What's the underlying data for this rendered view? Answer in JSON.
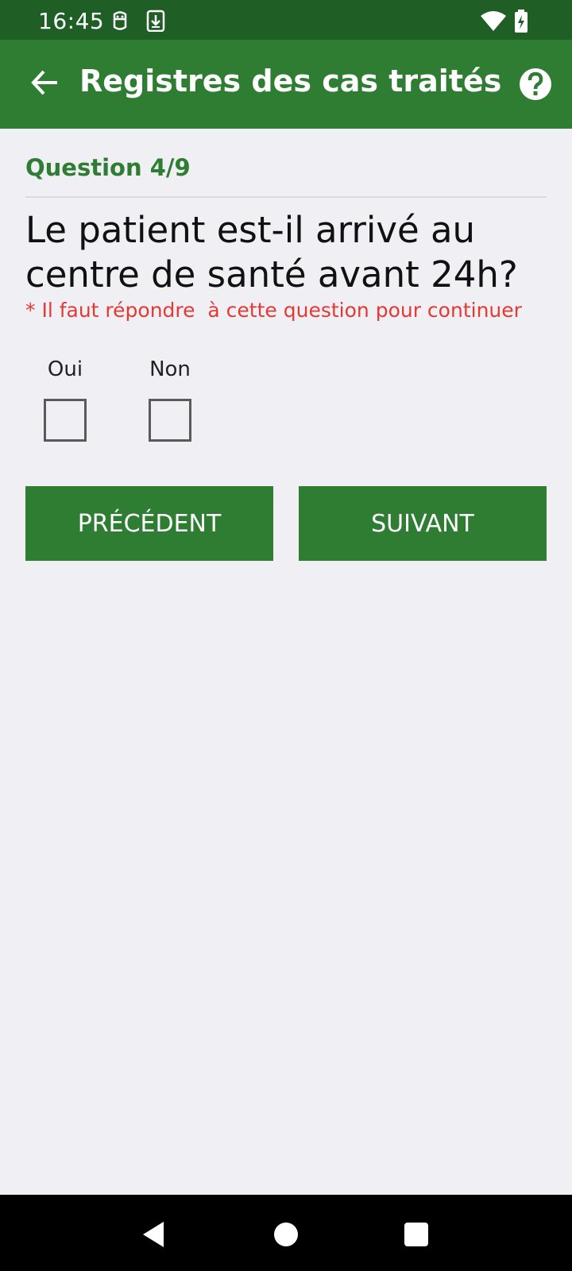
{
  "status_bar": {
    "time": "16:45",
    "icons": [
      "notification-app-icon",
      "download-icon",
      "wifi-icon",
      "battery-charging-icon"
    ]
  },
  "app_bar": {
    "title": "Registres des cas traités",
    "back_icon": "arrow-back-icon",
    "help_icon": "help-circle-icon"
  },
  "question": {
    "counter": "Question 4/9",
    "text": "Le patient est-il arrivé au centre de santé avant 24h?",
    "required_note": "* Il faut répondre  à cette question pour continuer",
    "options": [
      {
        "label": "Oui",
        "checked": false
      },
      {
        "label": "Non",
        "checked": false
      }
    ]
  },
  "navigation": {
    "previous_label": "PRÉCÉDENT",
    "next_label": "SUIVANT"
  },
  "system_nav": {
    "icons": [
      "back-triangle-icon",
      "home-circle-icon",
      "recents-square-icon"
    ]
  },
  "colors": {
    "status_bar": "#1f5e25",
    "primary": "#2e7d32",
    "background": "#efeff4",
    "error": "#e53935"
  }
}
